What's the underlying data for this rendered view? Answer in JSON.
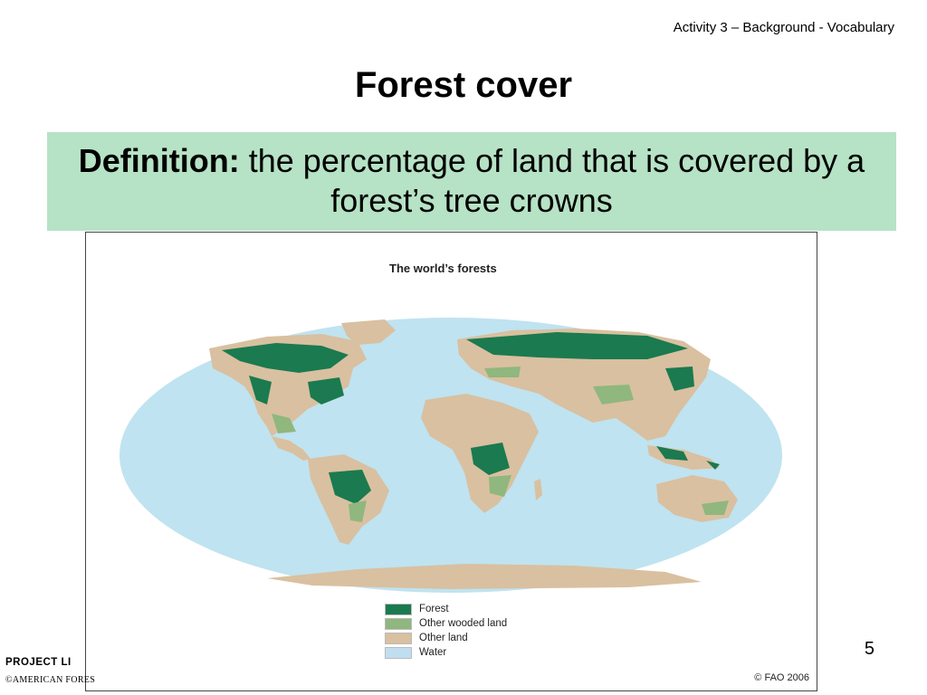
{
  "header": {
    "activity_tag": "Activity 3 – Background - Vocabulary"
  },
  "slide": {
    "title": "Forest cover",
    "definition_label": "Definition:",
    "definition_text": " the percentage of land that is covered by a forest’s tree crowns",
    "page_number": "5"
  },
  "map": {
    "title": "The world’s forests",
    "copyright": "© FAO 2006",
    "legend": [
      {
        "label": "Forest",
        "color": "#1b7a4f"
      },
      {
        "label": "Other wooded land",
        "color": "#8fb77e"
      },
      {
        "label": "Other land",
        "color": "#d9c0a0"
      },
      {
        "label": "Water",
        "color": "#bfdff0"
      }
    ],
    "colors": {
      "ocean": "#bfe3f0",
      "forest": "#1b7a4f",
      "wooded": "#8fb77e",
      "land": "#d9c0a0"
    }
  },
  "footer": {
    "logo_text": "PROJECT LI",
    "sub_text": "©AMERICAN FORES"
  }
}
